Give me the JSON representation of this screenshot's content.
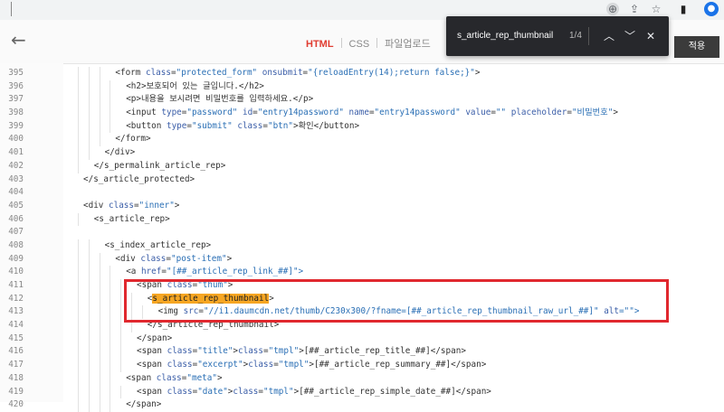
{
  "browser": {
    "icons": [
      "install-app-icon",
      "share-icon",
      "star-icon",
      "sidebar-icon",
      "profile-icon"
    ]
  },
  "editor": {
    "back_label": "←",
    "tabs": [
      {
        "label": "HTML",
        "active": true
      },
      {
        "label": "CSS",
        "active": false
      },
      {
        "label": "파일업로드",
        "active": false
      }
    ],
    "apply_label": "적용"
  },
  "find_bar": {
    "query": "s_article_rep_thumbnail",
    "count": "1/4",
    "prev_symbol": "︿",
    "next_symbol": "﹀",
    "close_symbol": "✕"
  },
  "code": {
    "lines": [
      {
        "num": "395",
        "indent": 3,
        "text": "<form class=\"protected_form\" onsubmit=\"{reloadEntry(14);return false;}\">"
      },
      {
        "num": "396",
        "indent": 4,
        "text": "<h2>보호되어 있는 글입니다.</h2>"
      },
      {
        "num": "397",
        "indent": 4,
        "text": "<p>내용을 보시려면 비밀번호를 입력하세요.</p>"
      },
      {
        "num": "398",
        "indent": 4,
        "text": "<input type=\"password\" id=\"entry14password\" name=\"entry14password\" value=\"\" placeholder=\"비밀번호\">"
      },
      {
        "num": "399",
        "indent": 4,
        "text": "<button type=\"submit\" class=\"btn\">확인</button>"
      },
      {
        "num": "400",
        "indent": 3,
        "text": "</form>"
      },
      {
        "num": "401",
        "indent": 2,
        "text": "</div>"
      },
      {
        "num": "402",
        "indent": 1,
        "text": "</s_permalink_article_rep>"
      },
      {
        "num": "403",
        "indent": 0,
        "text": "</s_article_protected>"
      },
      {
        "num": "404",
        "indent": 0,
        "text": ""
      },
      {
        "num": "405",
        "indent": 0,
        "text": "<div class=\"inner\">"
      },
      {
        "num": "406",
        "indent": 1,
        "text": "<s_article_rep>"
      },
      {
        "num": "407",
        "indent": 0,
        "text": ""
      },
      {
        "num": "408",
        "indent": 2,
        "text": "<s_index_article_rep>"
      },
      {
        "num": "409",
        "indent": 3,
        "text": "<div class=\"post-item\">"
      },
      {
        "num": "410",
        "indent": 4,
        "text": "<a href=\"[##_article_rep_link_##]\">"
      },
      {
        "num": "411",
        "indent": 5,
        "text": "<span class=\"thum\">"
      },
      {
        "num": "412",
        "indent": 6,
        "text": "<s_article_rep_thumbnail>"
      },
      {
        "num": "413",
        "indent": 7,
        "text": "<img src=\"//i1.daumcdn.net/thumb/C230x300/?fname=[##_article_rep_thumbnail_raw_url_##]\" alt=\"\">"
      },
      {
        "num": "414",
        "indent": 6,
        "text": "</s_article_rep_thumbnail>"
      },
      {
        "num": "415",
        "indent": 5,
        "text": "</span>"
      },
      {
        "num": "416",
        "indent": 5,
        "text": "<span class=\"title\">[##_article_rep_title_##]</span>"
      },
      {
        "num": "417",
        "indent": 5,
        "text": "<span class=\"excerpt\">[##_article_rep_summary_##]</span>"
      },
      {
        "num": "418",
        "indent": 4,
        "text": "<span class=\"meta\">"
      },
      {
        "num": "419",
        "indent": 5,
        "text": "<span class=\"date\">[##_article_rep_simple_date_##]</span>"
      },
      {
        "num": "420",
        "indent": 4,
        "text": "</span>"
      }
    ]
  }
}
